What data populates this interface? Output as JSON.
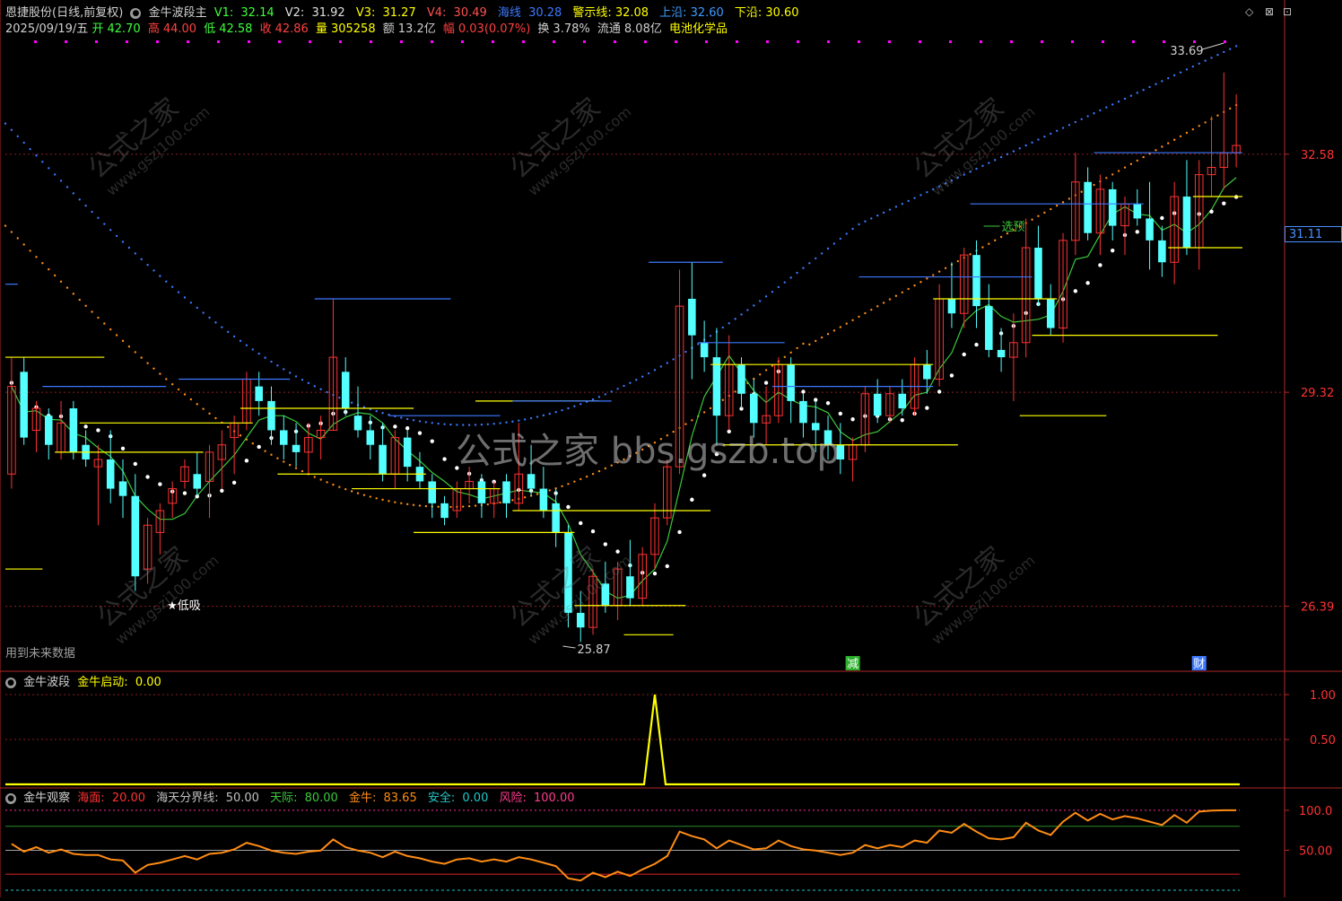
{
  "header": {
    "stock_name": "恩捷股份(日线,前复权)",
    "indicator_name": "金牛波段主",
    "v1_label": "V1:",
    "v1_value": "32.14",
    "v2_label": "V2:",
    "v2_value": "31.92",
    "v3_label": "V3:",
    "v3_value": "31.27",
    "v4_label": "V4:",
    "v4_value": "30.49",
    "haixian_label": "海线",
    "haixian_value": "30.28",
    "jingshi_label": "警示线:",
    "jingshi_value": "32.08",
    "shangyan_label": "上沿:",
    "shangyan_value": "32.60",
    "xiayan_label": "下沿:",
    "xiayan_value": "30.60",
    "date": "2025/09/19/五",
    "open_label": "开",
    "open_value": "42.70",
    "high_label": "高",
    "high_value": "44.00",
    "low_label": "低",
    "low_value": "42.58",
    "close_label": "收",
    "close_value": "42.86",
    "volume_label": "量",
    "volume_value": "305258",
    "amount_label": "额",
    "amount_value": "13.2亿",
    "change_label": "幅",
    "change_value": "0.03(0.07%)",
    "turnover_label": "换",
    "turnover_value": "3.78%",
    "float_label": "流通",
    "float_value": "8.08亿",
    "sector": "电池化学品"
  },
  "main_pane": {
    "future_data_note": "用到未来数据",
    "price_axis": [
      "32.58",
      "29.32",
      "26.39"
    ],
    "current_price_tag": "31.11",
    "high_annotation": "33.69",
    "low_annotation": "25.87",
    "buy_label": "★低吸",
    "select_label": "选预",
    "event_markers": [
      "减",
      "财"
    ],
    "watermark_center": "公式之家 bbs.gszb.top",
    "watermark_text": "公式之家",
    "watermark_url": "www.gszj100.com"
  },
  "pane2": {
    "title": "金牛波段",
    "series_label": "金牛启动:",
    "series_value": "0.00",
    "axis": [
      "1.00",
      "0.50"
    ]
  },
  "pane3": {
    "title": "金牛观察",
    "haimian_label": "海面:",
    "haimian_value": "20.00",
    "fenjie_label": "海天分界线:",
    "fenjie_value": "50.00",
    "tianji_label": "天际:",
    "tianji_value": "80.00",
    "jinniu_label": "金牛:",
    "jinniu_value": "83.65",
    "anquan_label": "安全:",
    "anquan_value": "0.00",
    "fengxian_label": "风险:",
    "fengxian_value": "100.00",
    "axis": [
      "100.0",
      "50.00"
    ]
  },
  "colors": {
    "up": "#ff3232",
    "down": "#54ffff",
    "ma": "#3cc83c",
    "yellow": "#ffff00",
    "blue": "#3c78ff",
    "orange": "#ff8c14",
    "magenta": "#ff00ff"
  },
  "chart_data": {
    "type": "candlestick",
    "price_range": [
      25.5,
      34.2
    ],
    "candles": [
      [
        28.2,
        29.8,
        28.0,
        29.4
      ],
      [
        29.6,
        29.8,
        28.6,
        28.7
      ],
      [
        28.8,
        29.2,
        28.5,
        29.1
      ],
      [
        29.0,
        29.1,
        28.4,
        28.6
      ],
      [
        28.5,
        29.2,
        28.4,
        28.9
      ],
      [
        29.1,
        29.2,
        28.4,
        28.5
      ],
      [
        28.6,
        28.8,
        28.3,
        28.4
      ],
      [
        28.3,
        28.6,
        27.5,
        28.4
      ],
      [
        28.4,
        28.8,
        27.8,
        28.0
      ],
      [
        28.1,
        28.4,
        27.6,
        27.9
      ],
      [
        27.9,
        28.2,
        26.6,
        26.8
      ],
      [
        26.9,
        27.6,
        26.7,
        27.5
      ],
      [
        27.4,
        27.8,
        27.1,
        27.7
      ],
      [
        27.8,
        28.1,
        27.6,
        28.0
      ],
      [
        28.1,
        28.4,
        28.0,
        28.3
      ],
      [
        28.2,
        28.5,
        27.9,
        28.0
      ],
      [
        28.1,
        28.6,
        27.6,
        28.5
      ],
      [
        28.4,
        28.8,
        28.0,
        28.6
      ],
      [
        28.7,
        29.0,
        28.2,
        28.9
      ],
      [
        28.9,
        29.6,
        28.8,
        29.5
      ],
      [
        29.4,
        29.6,
        29.0,
        29.2
      ],
      [
        29.2,
        29.4,
        28.6,
        28.8
      ],
      [
        28.8,
        29.0,
        28.4,
        28.6
      ],
      [
        28.6,
        28.9,
        28.3,
        28.5
      ],
      [
        28.5,
        28.9,
        28.2,
        28.7
      ],
      [
        28.7,
        29.0,
        28.4,
        28.8
      ],
      [
        28.8,
        30.6,
        28.8,
        29.8
      ],
      [
        29.6,
        29.8,
        29.0,
        29.1
      ],
      [
        29.0,
        29.4,
        28.7,
        28.8
      ],
      [
        28.8,
        29.0,
        28.4,
        28.6
      ],
      [
        28.6,
        28.9,
        28.1,
        28.2
      ],
      [
        28.2,
        28.8,
        28.0,
        28.7
      ],
      [
        28.7,
        28.8,
        28.1,
        28.3
      ],
      [
        28.3,
        28.5,
        28.0,
        28.1
      ],
      [
        28.1,
        28.2,
        27.6,
        27.8
      ],
      [
        27.8,
        27.9,
        27.5,
        27.6
      ],
      [
        27.7,
        28.1,
        27.6,
        28.0
      ],
      [
        28.0,
        28.3,
        27.8,
        28.1
      ],
      [
        28.1,
        28.2,
        27.6,
        27.8
      ],
      [
        27.8,
        28.1,
        27.6,
        28.0
      ],
      [
        28.1,
        28.2,
        27.6,
        27.8
      ],
      [
        27.8,
        28.9,
        27.7,
        28.2
      ],
      [
        28.2,
        28.6,
        27.9,
        28.0
      ],
      [
        28.0,
        28.3,
        27.6,
        27.7
      ],
      [
        27.8,
        28.0,
        27.2,
        27.4
      ],
      [
        27.4,
        27.5,
        26.1,
        26.3
      ],
      [
        26.3,
        26.6,
        25.9,
        26.1
      ],
      [
        26.1,
        26.9,
        26.0,
        26.8
      ],
      [
        26.7,
        27.0,
        26.3,
        26.4
      ],
      [
        26.4,
        27.0,
        26.2,
        26.9
      ],
      [
        26.8,
        27.3,
        26.4,
        26.5
      ],
      [
        26.5,
        27.2,
        26.4,
        27.1
      ],
      [
        27.1,
        27.8,
        26.9,
        27.6
      ],
      [
        27.6,
        28.4,
        27.5,
        28.3
      ],
      [
        28.3,
        31.0,
        28.2,
        30.5
      ],
      [
        30.6,
        31.1,
        29.5,
        30.1
      ],
      [
        30.0,
        30.3,
        29.6,
        29.8
      ],
      [
        29.8,
        30.2,
        28.6,
        29.0
      ],
      [
        29.0,
        30.1,
        28.8,
        29.7
      ],
      [
        29.7,
        29.8,
        29.1,
        29.3
      ],
      [
        29.3,
        29.5,
        28.7,
        28.9
      ],
      [
        28.9,
        29.4,
        28.6,
        29.0
      ],
      [
        29.0,
        29.8,
        28.9,
        29.7
      ],
      [
        29.7,
        29.8,
        28.9,
        29.2
      ],
      [
        29.2,
        29.3,
        28.7,
        28.9
      ],
      [
        28.9,
        29.2,
        28.5,
        28.8
      ],
      [
        28.8,
        29.0,
        28.4,
        28.6
      ],
      [
        28.6,
        28.9,
        28.2,
        28.4
      ],
      [
        28.4,
        28.7,
        28.1,
        28.6
      ],
      [
        28.6,
        29.4,
        28.5,
        29.3
      ],
      [
        29.3,
        29.5,
        28.9,
        29.0
      ],
      [
        29.0,
        29.4,
        28.9,
        29.3
      ],
      [
        29.3,
        29.5,
        29.0,
        29.1
      ],
      [
        29.1,
        29.8,
        29.0,
        29.7
      ],
      [
        29.7,
        29.9,
        29.3,
        29.5
      ],
      [
        29.5,
        30.8,
        29.4,
        30.6
      ],
      [
        30.6,
        31.1,
        30.2,
        30.4
      ],
      [
        30.4,
        31.3,
        30.2,
        31.2
      ],
      [
        31.2,
        31.4,
        30.2,
        30.5
      ],
      [
        30.5,
        30.8,
        29.8,
        29.9
      ],
      [
        29.9,
        30.2,
        29.6,
        29.8
      ],
      [
        29.8,
        30.4,
        29.2,
        30.0
      ],
      [
        30.0,
        31.7,
        29.8,
        31.3
      ],
      [
        31.3,
        31.6,
        30.5,
        30.6
      ],
      [
        30.6,
        30.8,
        30.1,
        30.2
      ],
      [
        30.2,
        31.5,
        30.0,
        31.4
      ],
      [
        31.4,
        32.6,
        31.2,
        32.2
      ],
      [
        32.2,
        32.4,
        31.4,
        31.5
      ],
      [
        31.5,
        32.3,
        31.2,
        32.1
      ],
      [
        32.1,
        32.2,
        31.4,
        31.6
      ],
      [
        31.6,
        32.0,
        31.2,
        31.9
      ],
      [
        31.9,
        32.1,
        31.6,
        31.7
      ],
      [
        31.7,
        32.2,
        31.0,
        31.4
      ],
      [
        31.4,
        31.6,
        30.9,
        31.1
      ],
      [
        31.1,
        32.2,
        30.8,
        32.0
      ],
      [
        32.0,
        32.5,
        31.2,
        31.3
      ],
      [
        31.3,
        32.5,
        31.0,
        32.3
      ],
      [
        32.3,
        33.1,
        32.0,
        32.4
      ],
      [
        32.4,
        33.7,
        32.1,
        32.6
      ],
      [
        32.6,
        33.4,
        32.4,
        32.7
      ]
    ]
  }
}
